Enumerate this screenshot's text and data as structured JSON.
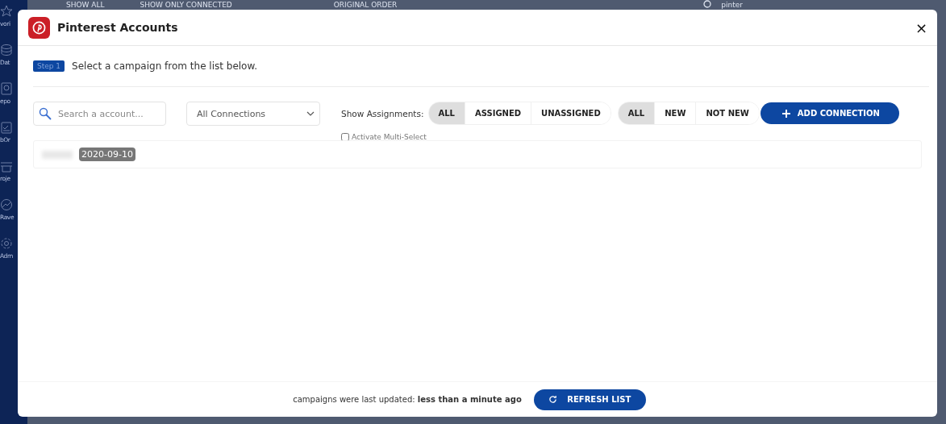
{
  "background": {
    "toolbar": [
      "SHOW ALL",
      "SHOW ONLY CONNECTED",
      "ORIGINAL ORDER"
    ],
    "search_value": "pinter",
    "sidebar_labels": [
      "vori",
      "Dat",
      "epo",
      "bOr",
      "roje",
      "Rave",
      "Adm"
    ]
  },
  "dialog": {
    "title": "Pinterest Accounts",
    "close": "×",
    "step": {
      "badge": "Step 1",
      "text": "Select a campaign from the list below."
    },
    "search": {
      "placeholder": "Search a account..."
    },
    "connection_select": {
      "value": "All Connections"
    },
    "assignments": {
      "label": "Show Assignments:",
      "options": [
        {
          "label": "ALL",
          "selected": true
        },
        {
          "label": "ASSIGNED",
          "selected": false
        },
        {
          "label": "UNASSIGNED",
          "selected": false
        }
      ]
    },
    "new_filter": {
      "options": [
        {
          "label": "ALL",
          "selected": true
        },
        {
          "label": "NEW",
          "selected": false
        },
        {
          "label": "NOT NEW",
          "selected": false
        }
      ]
    },
    "add_button": "ADD CONNECTION",
    "multi_select": {
      "label": "Activate Multi-Select",
      "checked": false
    },
    "accounts": [
      {
        "date": "2020-09-10"
      }
    ],
    "footer": {
      "text": "campaigns were last updated: **less than a minute ago**",
      "button": "REFRESH LIST"
    }
  }
}
